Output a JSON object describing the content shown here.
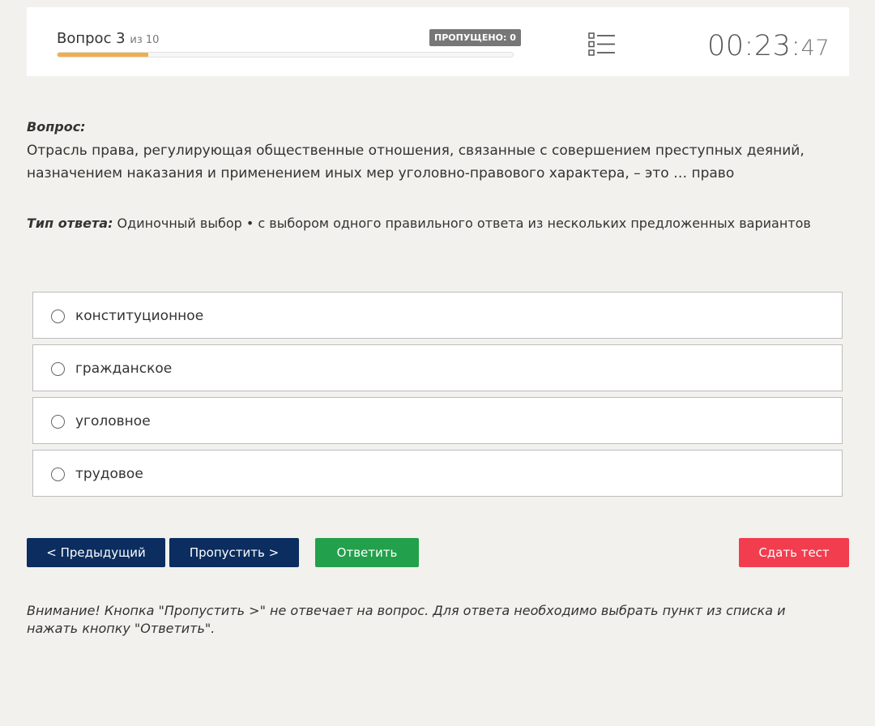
{
  "header": {
    "question_label": "Вопрос 3",
    "of_total": "из 10",
    "progress_fraction": 0.2,
    "skipped_badge": "ПРОПУЩЕНО: 0",
    "list_icon": "list-icon",
    "timer_main": "00:23:",
    "timer_seconds": "47"
  },
  "question": {
    "label": "Вопрос:",
    "text": "Отрасль права, регулирующая общественные отношения, связанные с совершением преступных деяний, назначением наказания и применением иных мер уголовно-правового характера, – это … право"
  },
  "answer_type": {
    "label": "Тип ответа:",
    "value": " Одиночный выбор • с выбором одного правильного ответа из нескольких предложенных вариантов"
  },
  "options": [
    {
      "label": "конституционное"
    },
    {
      "label": "гражданское"
    },
    {
      "label": "уголовное"
    },
    {
      "label": "трудовое"
    }
  ],
  "buttons": {
    "prev": "< Предыдущий",
    "skip": "Пропустить >",
    "answer": "Ответить",
    "submit": "Сдать тест"
  },
  "warning": "Внимание! Кнопка \"Пропустить >\" не отвечает на вопрос. Для ответа необходимо выбрать пункт из списка и нажать кнопку \"Ответить\".",
  "colors": {
    "progress": "#f0ad4e",
    "nav_button": "#0b2d5f",
    "answer_button": "#22a04b",
    "submit_button": "#f23d4f"
  }
}
